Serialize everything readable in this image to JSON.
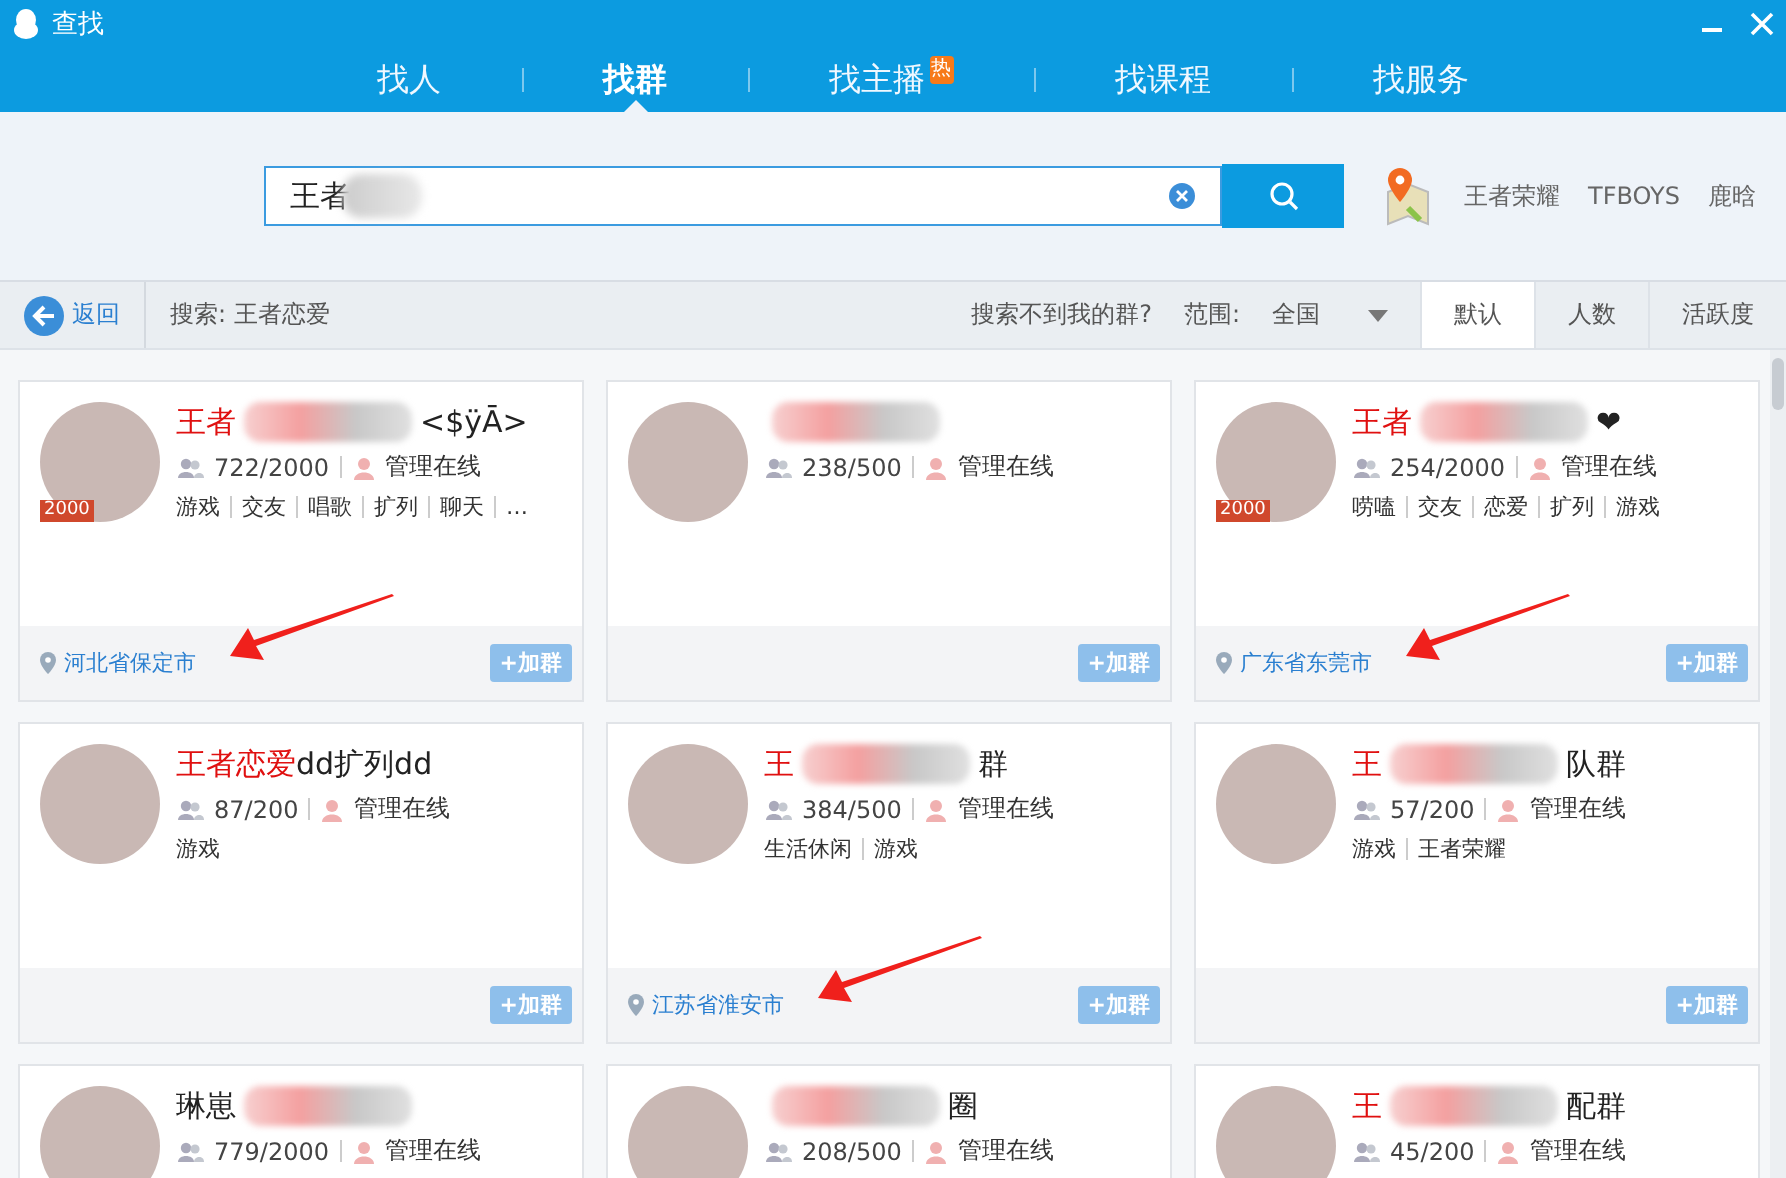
{
  "window": {
    "title": "查找"
  },
  "tabs": [
    {
      "label": "找人",
      "selected": false
    },
    {
      "label": "找群",
      "selected": true
    },
    {
      "label": "找主播",
      "selected": false,
      "badge": "热"
    },
    {
      "label": "找课程",
      "selected": false
    },
    {
      "label": "找服务",
      "selected": false
    }
  ],
  "search": {
    "value": "王者",
    "blurred": true
  },
  "hot_words": [
    "王者荣耀",
    "TFBOYS",
    "鹿晗"
  ],
  "toolbar": {
    "back": "返回",
    "query": "搜索: 王者恋爱",
    "help_link": "搜索不到我的群?",
    "range_label": "范围:",
    "range_value": "全国"
  },
  "sort_tabs": [
    {
      "label": "默认",
      "selected": true
    },
    {
      "label": "人数",
      "selected": false
    },
    {
      "label": "活跃度",
      "selected": false
    }
  ],
  "cards": [
    {
      "title": {
        "highlight": "王者",
        "blurred": true,
        "rest": "<$ÿĀ>"
      },
      "badge": "2000",
      "members": "722/2000",
      "admin": "管理在线",
      "tags": [
        "游戏",
        "交友",
        "唱歌",
        "扩列",
        "聊天",
        "…"
      ],
      "location": "河北省保定市",
      "join": "+加群",
      "annotated": true
    },
    {
      "title": {
        "blurred": true
      },
      "members": "238/500",
      "admin": "管理在线",
      "join": "+加群",
      "annotated": false
    },
    {
      "title": {
        "highlight": "王者",
        "blurred": true,
        "rest": "❤"
      },
      "badge": "2000",
      "members": "254/2000",
      "admin": "管理在线",
      "tags": [
        "唠嗑",
        "交友",
        "恋爱",
        "扩列",
        "游戏"
      ],
      "location": "广东省东莞市",
      "join": "+加群",
      "annotated": true
    },
    {
      "title": {
        "highlight": "王者恋爱",
        "blurred": false,
        "rest": "dd扩列dd"
      },
      "members": "87/200",
      "admin": "管理在线",
      "tags": [
        "游戏"
      ],
      "join": "+加群",
      "annotated": false
    },
    {
      "title": {
        "highlight": "王",
        "blurred": true,
        "rest": "群"
      },
      "members": "384/500",
      "admin": "管理在线",
      "tags": [
        "生活休闲",
        "游戏"
      ],
      "location": "江苏省淮安市",
      "join": "+加群",
      "annotated": true
    },
    {
      "title": {
        "highlight": "王",
        "blurred": true,
        "rest": "队群"
      },
      "members": "57/200",
      "admin": "管理在线",
      "tags": [
        "游戏",
        "王者荣耀"
      ],
      "join": "+加群",
      "annotated": false
    },
    {
      "title": {
        "prefix": "琳崽",
        "blurred": true
      },
      "members": "779/2000",
      "admin": "管理在线",
      "annotated": false
    },
    {
      "title": {
        "blurred": true,
        "rest": "圈"
      },
      "members": "208/500",
      "admin": "管理在线",
      "annotated": false
    },
    {
      "title": {
        "highlight": "王",
        "blurred": true,
        "rest": "配群"
      },
      "members": "45/200",
      "admin": "管理在线",
      "annotated": false
    }
  ]
}
